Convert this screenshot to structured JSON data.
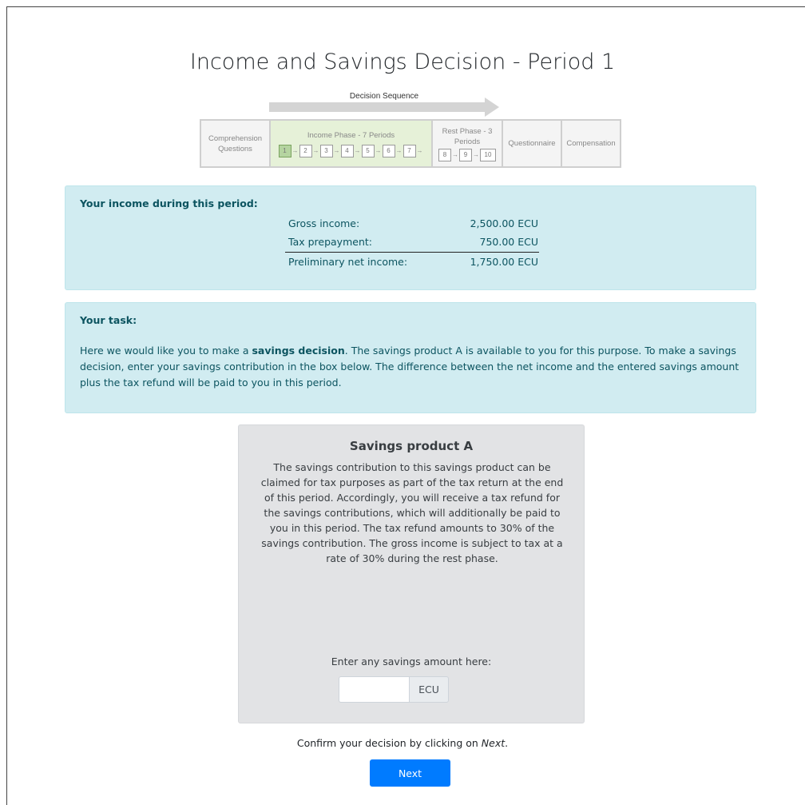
{
  "page": {
    "title": "Income and Savings Decision - Period 1"
  },
  "sequence": {
    "label": "Decision Sequence",
    "comprehension": "Comprehension Questions",
    "income_phase": "Income Phase - 7 Periods",
    "income_steps": [
      "1",
      "2",
      "3",
      "4",
      "5",
      "6",
      "7"
    ],
    "rest_phase": "Rest Phase - 3 Periods",
    "rest_steps": [
      "8",
      "9",
      "10"
    ],
    "questionnaire": "Questionnaire",
    "compensation": "Compensation",
    "current_period": "1"
  },
  "income": {
    "heading": "Your income during this period:",
    "rows": [
      {
        "label": "Gross income:",
        "value": "2,500.00 ECU"
      },
      {
        "label": "Tax prepayment:",
        "value": "750.00 ECU"
      },
      {
        "label": "Preliminary net income:",
        "value": "1,750.00 ECU"
      }
    ]
  },
  "task": {
    "heading": "Your task:",
    "text_before": "Here we would like you to make a ",
    "text_bold": "savings decision",
    "text_after": ". The savings product A is available to you for this purpose. To make a savings decision, enter your savings contribution in the box below. The difference between the net income and the entered savings amount plus the tax refund will be paid to you in this period."
  },
  "product": {
    "title": "Savings product A",
    "description": "The savings contribution to this savings product can be claimed for tax purposes as part of the tax return at the end of this period. Accordingly, you will receive a tax refund for the savings contributions, which will additionally be paid to you in this period. The tax refund amounts to 30% of the savings contribution. The gross income is subject to tax at a rate of 30% during the rest phase.",
    "amount_label": "Enter any savings amount here:",
    "amount_value": "",
    "amount_unit": "ECU"
  },
  "confirm": {
    "text_before": "Confirm your decision by clicking on ",
    "text_italic": "Next",
    "text_after": "."
  },
  "next_button": {
    "label": "Next"
  }
}
